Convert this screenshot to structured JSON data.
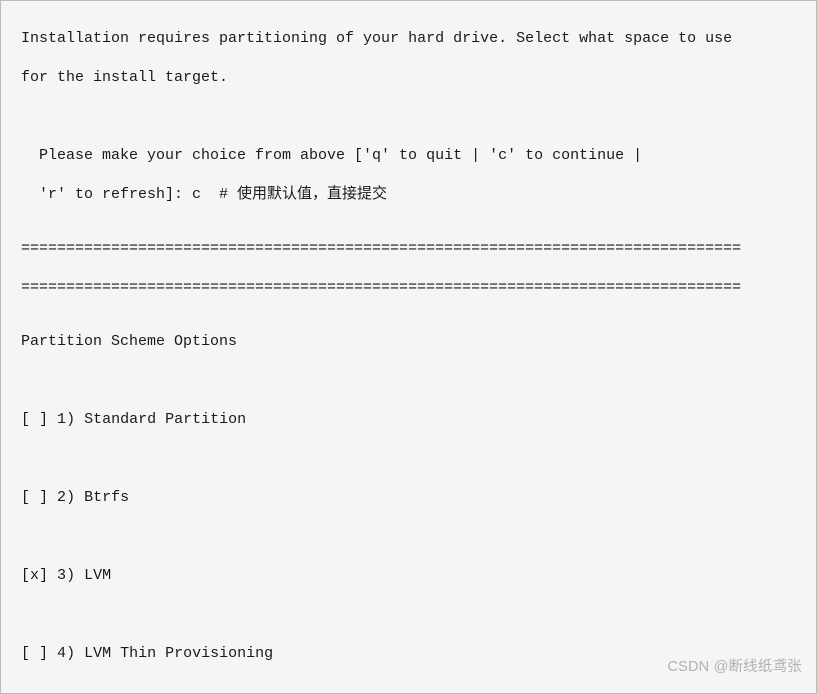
{
  "intro": {
    "line1": "Installation requires partitioning of your hard drive. Select what space to use",
    "line2": "for the install target."
  },
  "prompt": {
    "line1": "Please make your choice from above ['q' to quit | 'c' to continue |",
    "line2_prefix": "'r' to refresh]: ",
    "input_value": "c",
    "comment": "  # 使用默认值，直接提交"
  },
  "separator": "================================================================================",
  "section_title": "Partition Scheme Options",
  "options": [
    {
      "mark": " ",
      "num": "1",
      "label": "Standard Partition"
    },
    {
      "mark": " ",
      "num": "2",
      "label": "Btrfs"
    },
    {
      "mark": "x",
      "num": "3",
      "label": "LVM"
    },
    {
      "mark": " ",
      "num": "4",
      "label": "LVM Thin Provisioning"
    }
  ],
  "watermark": "CSDN @断线纸鸢张"
}
